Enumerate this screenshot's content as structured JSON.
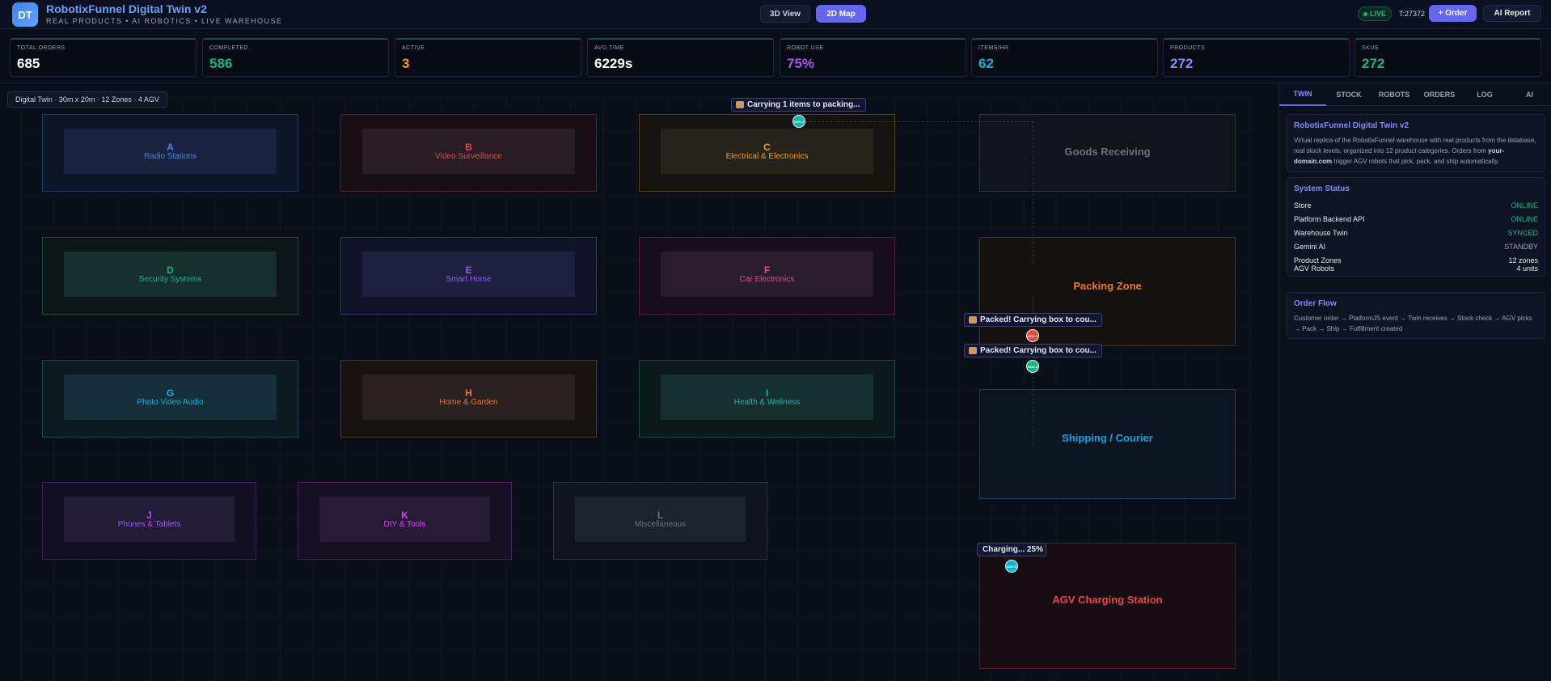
{
  "header": {
    "logo_text": "DT",
    "title": "RobotixFunnel Digital Twin v2",
    "subtitle": "REAL PRODUCTS • AI ROBOTICS • LIVE WAREHOUSE",
    "view_3d": "3D View",
    "view_2d": "2D Map",
    "live": "LIVE",
    "tick": "T:27372",
    "order_btn": "+ Order",
    "ai_btn": "AI Report"
  },
  "stats": [
    {
      "label": "TOTAL ORDERS",
      "value": "685",
      "color": "#ffffff"
    },
    {
      "label": "COMPLETED",
      "value": "586",
      "color": "#10b981"
    },
    {
      "label": "ACTIVE",
      "value": "3",
      "color": "#f59e0b"
    },
    {
      "label": "AVG TIME",
      "value": "6229s",
      "color": "#ffffff"
    },
    {
      "label": "ROBOT USE",
      "value": "75%",
      "color": "#a855f7"
    },
    {
      "label": "ITEMS/HR",
      "value": "62",
      "color": "#06b6d4"
    },
    {
      "label": "PRODUCTS",
      "value": "272",
      "color": "#818cf8"
    },
    {
      "label": "SKUS",
      "value": "272",
      "color": "#10b981"
    }
  ],
  "map": {
    "label": "Digital Twin · 30m x 20m · 12 Zones · 4 AGV",
    "zones": [
      {
        "letter": "A",
        "name": "Radio Stations",
        "color": "#3b82f6"
      },
      {
        "letter": "B",
        "name": "Video Surveillance",
        "color": "#ef4444"
      },
      {
        "letter": "C",
        "name": "Electrical & Electronics",
        "color": "#f59e0b"
      },
      {
        "letter": "D",
        "name": "Security Systems",
        "color": "#10b981"
      },
      {
        "letter": "E",
        "name": "Smart Home",
        "color": "#8b5cf6"
      },
      {
        "letter": "F",
        "name": "Car Electronics",
        "color": "#ec4899"
      },
      {
        "letter": "G",
        "name": "Photo Video Audio",
        "color": "#06b6d4"
      },
      {
        "letter": "H",
        "name": "Home & Garden",
        "color": "#f97316"
      },
      {
        "letter": "I",
        "name": "Health & Wellness",
        "color": "#14b8a6"
      },
      {
        "letter": "J",
        "name": "Phones & Tablets",
        "color": "#a855f7"
      },
      {
        "letter": "K",
        "name": "DIY & Tools",
        "color": "#d946ef"
      },
      {
        "letter": "L",
        "name": "Miscellaneous",
        "color": "#6b7280"
      }
    ],
    "special": {
      "receiving": "Goods Receiving",
      "packing": "Packing Zone",
      "shipping": "Shipping / Courier",
      "charging": "AGV Charging Station"
    },
    "bubbles": {
      "b1": "Carrying 1 items to packing...",
      "b2": "Packed! Carrying box to cou...",
      "b3": "Packed! Carrying box to cou...",
      "b4": "Charging... 25%"
    },
    "robots": {
      "r1": "AGV-1",
      "r2": "AGV-2",
      "r3": "AGV-3",
      "r4": "AGV-4"
    }
  },
  "side": {
    "tabs": [
      "TWIN",
      "STOCK",
      "ROBOTS",
      "ORDERS",
      "LOG",
      "AI"
    ],
    "intro": {
      "title": "RobotixFunnel Digital Twin v2",
      "text_a": "Virtual replica of the RobotixFunnel warehouse with real products from the database, real stock levels, organized into 12 product categories. Orders from ",
      "text_bold": "your-domain.com",
      "text_b": " trigger AGV robots that pick, pack, and ship automatically."
    },
    "system": {
      "title": "System Status",
      "rows": [
        {
          "key": "Store",
          "value": "ONLINE",
          "color": "#10b981"
        },
        {
          "key": "Platform Backend API",
          "value": "ONLINE",
          "color": "#10b981"
        },
        {
          "key": "Warehouse Twin",
          "value": "SYNCED",
          "color": "#10b981"
        },
        {
          "key": "Gemini AI",
          "value": "STANDBY",
          "color": "#9ca3af"
        },
        {
          "key": "Product Zones",
          "value": "12 zones",
          "color": "#e5e7eb"
        },
        {
          "key": "AGV Robots",
          "value": "4 units",
          "color": "#e5e7eb"
        }
      ]
    },
    "flow": {
      "title": "Order Flow",
      "text": "Customer order → PlatformJS event → Twin receives → Stock check → AGV picks → Pack → Ship → Fulfillment created"
    }
  }
}
